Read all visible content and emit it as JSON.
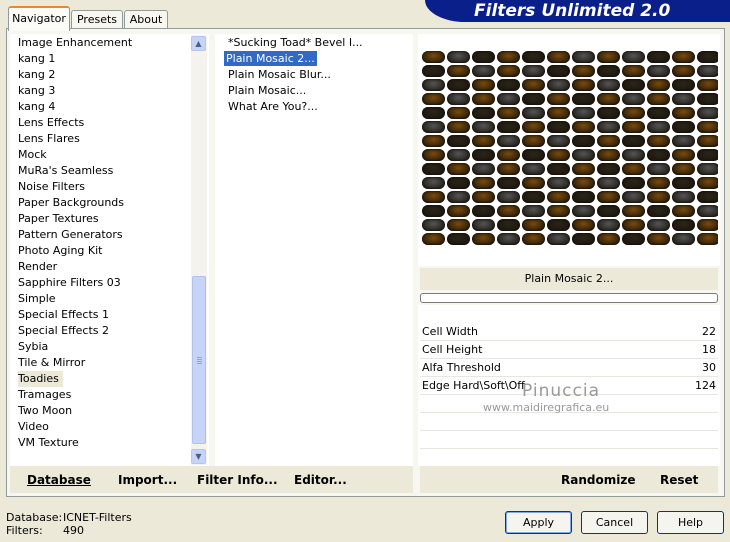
{
  "banner": {
    "title": "Filters Unlimited 2.0"
  },
  "tabs": [
    {
      "label": "Navigator",
      "active": true
    },
    {
      "label": "Presets",
      "active": false
    },
    {
      "label": "About",
      "active": false
    }
  ],
  "categories": {
    "items": [
      "Image Enhancement",
      "kang 1",
      "kang 2",
      "kang 3",
      "kang 4",
      "Lens Effects",
      "Lens Flares",
      "Mock",
      "MuRa's Seamless",
      "Noise Filters",
      "Paper Backgrounds",
      "Paper Textures",
      "Pattern Generators",
      "Photo Aging Kit",
      "Render",
      "Sapphire Filters 03",
      "Simple",
      "Special Effects 1",
      "Special Effects 2",
      "Sybia",
      "Tile & Mirror",
      "Toadies",
      "Tramages",
      "Two Moon",
      "Video",
      "VM Texture"
    ],
    "selected": "Toadies"
  },
  "filters": {
    "items": [
      "*Sucking Toad*  Bevel I...",
      "Plain Mosaic 2...",
      "Plain Mosaic Blur...",
      "Plain Mosaic...",
      "What Are You?..."
    ],
    "selected": "Plain Mosaic 2..."
  },
  "preview": {
    "filter_name": "Plain Mosaic 2..."
  },
  "params": [
    {
      "label": "Cell Width",
      "value": "22"
    },
    {
      "label": "Cell Height",
      "value": "18"
    },
    {
      "label": "Alfa Threshold",
      "value": "30"
    },
    {
      "label": "Edge Hard\\Soft\\Off",
      "value": "124"
    }
  ],
  "watermark": {
    "line1": "Pinuccia",
    "line2": "www.maidiregrafica.eu"
  },
  "bottom_links": {
    "database": "Database",
    "import": "Import...",
    "filter_info": "Filter Info...",
    "editor": "Editor...",
    "randomize": "Randomize",
    "reset": "Reset"
  },
  "status": {
    "database_label": "Database:",
    "database_value": "ICNET-Filters",
    "filters_label": "Filters:",
    "filters_value": "490"
  },
  "buttons": {
    "apply": "Apply",
    "cancel": "Cancel",
    "help": "Help"
  },
  "colors": {
    "banner": "#0b1f8a",
    "selection": "#316ac5",
    "tile_brown": "#7a4a0c",
    "tile_gray": "#555555"
  }
}
